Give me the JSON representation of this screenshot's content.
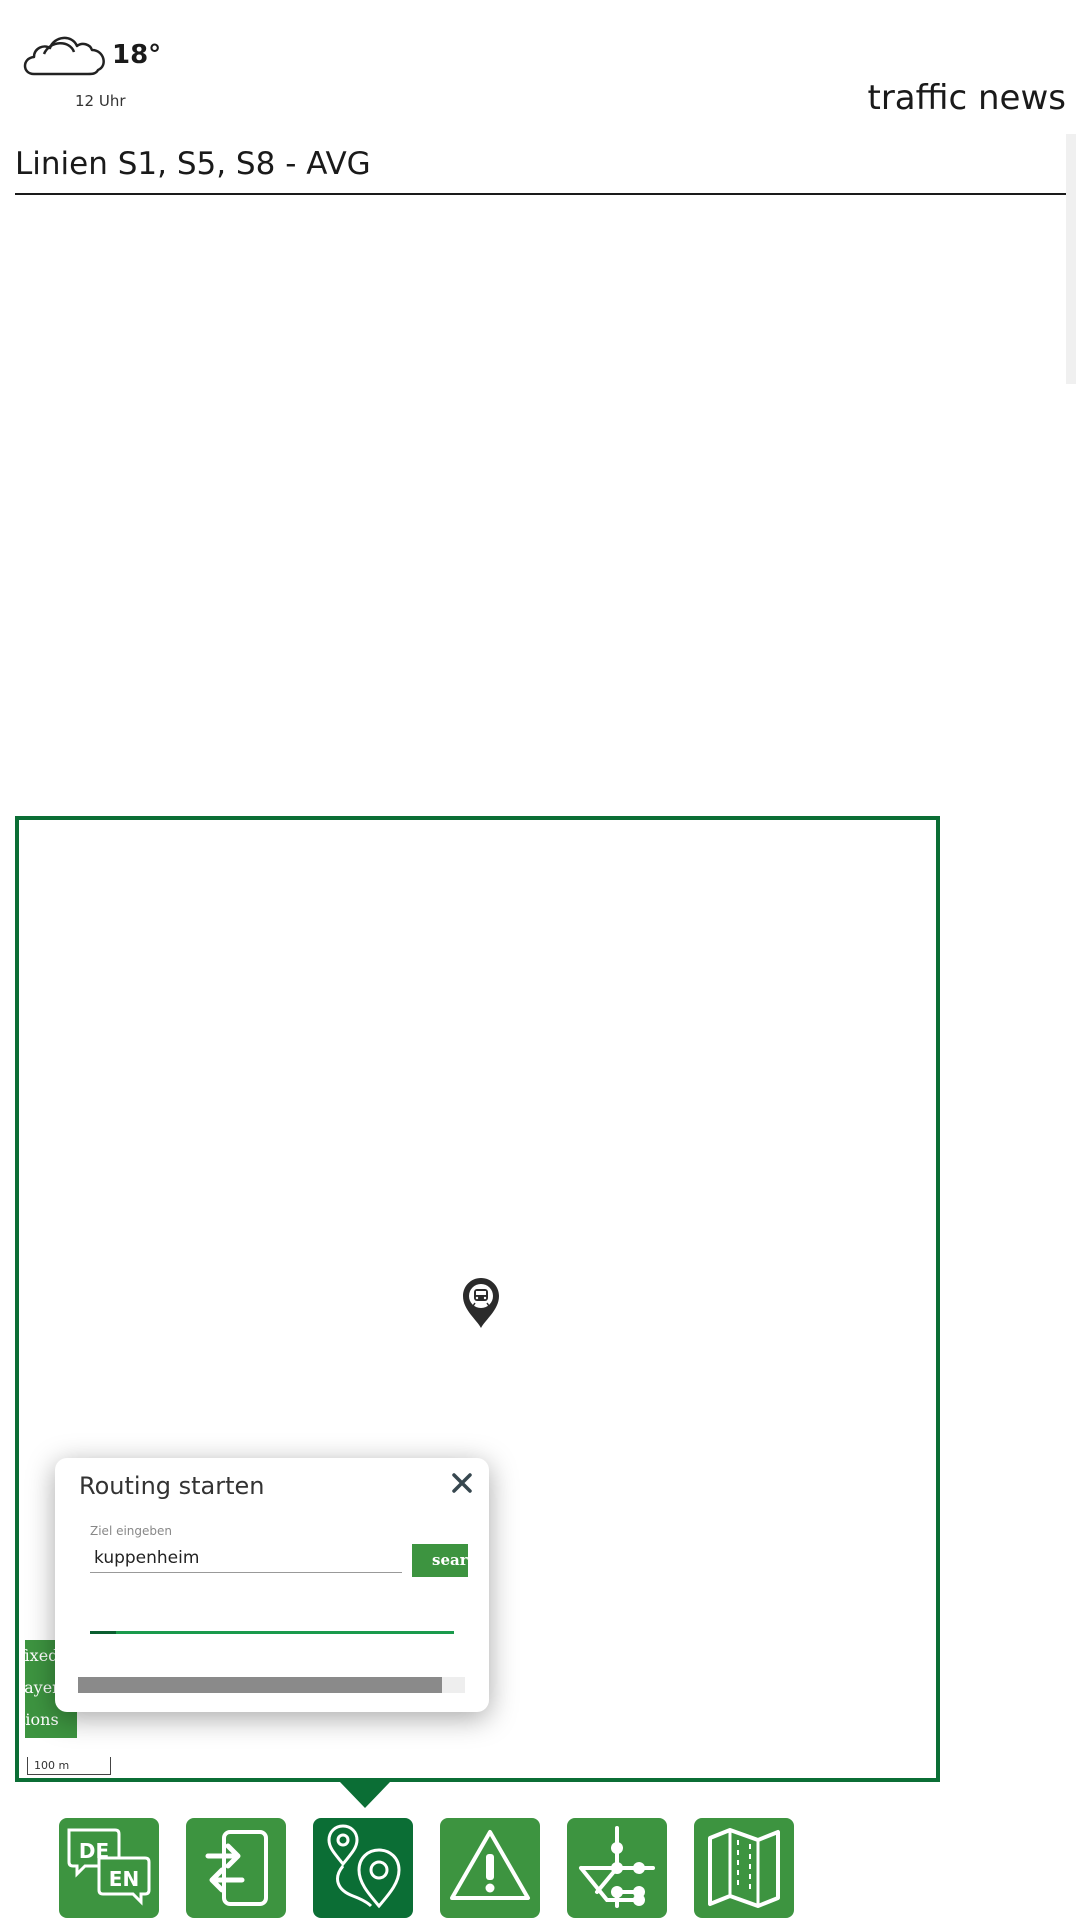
{
  "weather": {
    "icon": "cloud-icon",
    "temperature": "18°",
    "time": "12 Uhr"
  },
  "header": {
    "app_title": "traffic news"
  },
  "news": {
    "headline": "Linien S1, S5, S8 - AVG"
  },
  "map": {
    "marker_icon": "train-location-pin-icon",
    "scale_label": "100 m",
    "layer_tab_lines": [
      "fixed",
      "layers",
      "tions"
    ]
  },
  "routing": {
    "title": "Routing starten",
    "destination_label": "Ziel eingeben",
    "destination_value": "kuppenheim",
    "search_label": "search"
  },
  "toolbar": {
    "buttons": [
      {
        "name": "language-toggle",
        "icon": "language-de-en-icon",
        "label_de": "DE",
        "label_en": "EN",
        "active": false
      },
      {
        "name": "transfer-to-phone",
        "icon": "phone-transfer-icon",
        "active": false
      },
      {
        "name": "routing",
        "icon": "route-pin-icon",
        "active": true
      },
      {
        "name": "traffic-warnings",
        "icon": "warning-icon",
        "active": false
      },
      {
        "name": "network-map",
        "icon": "network-lines-icon",
        "active": false
      },
      {
        "name": "map-view",
        "icon": "folded-map-icon",
        "active": false
      }
    ]
  },
  "colors": {
    "primary_green": "#3d9440",
    "dark_green": "#0b6e35",
    "progress_green": "#1a9a4c"
  }
}
